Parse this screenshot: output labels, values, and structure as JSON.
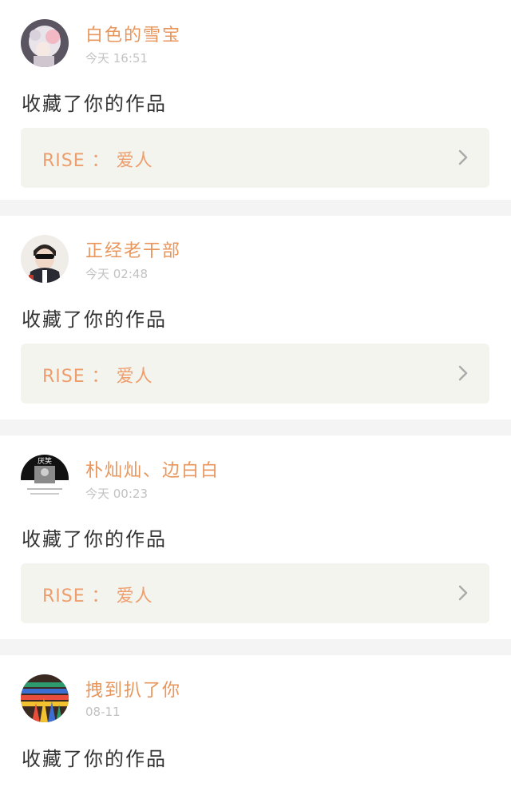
{
  "items": [
    {
      "name": "白色的雪宝",
      "time": "今天 16:51",
      "action": "收藏了你的作品",
      "work_title": "RISE ： 爱人",
      "avatar": "pink-hair-girl-avatar"
    },
    {
      "name": "正经老干部",
      "time": "今天 02:48",
      "action": "收藏了你的作品",
      "work_title": "RISE ： 爱人",
      "avatar": "boy-sunglasses-avatar"
    },
    {
      "name": "朴灿灿、边白白",
      "time": "今天 00:23",
      "action": "收藏了你的作品",
      "work_title": "RISE ： 爱人",
      "avatar": "black-white-photo-avatar",
      "avatar_caption": "厌笑"
    },
    {
      "name": "拽到扒了你",
      "time": "08-11",
      "action": "收藏了你的作品",
      "avatar": "colored-pencils-avatar"
    }
  ],
  "colors": {
    "accent": "#e8965c",
    "card_bg": "#f4f4ee",
    "page_bg": "#f4f4f4",
    "time": "#c2c2c2"
  }
}
